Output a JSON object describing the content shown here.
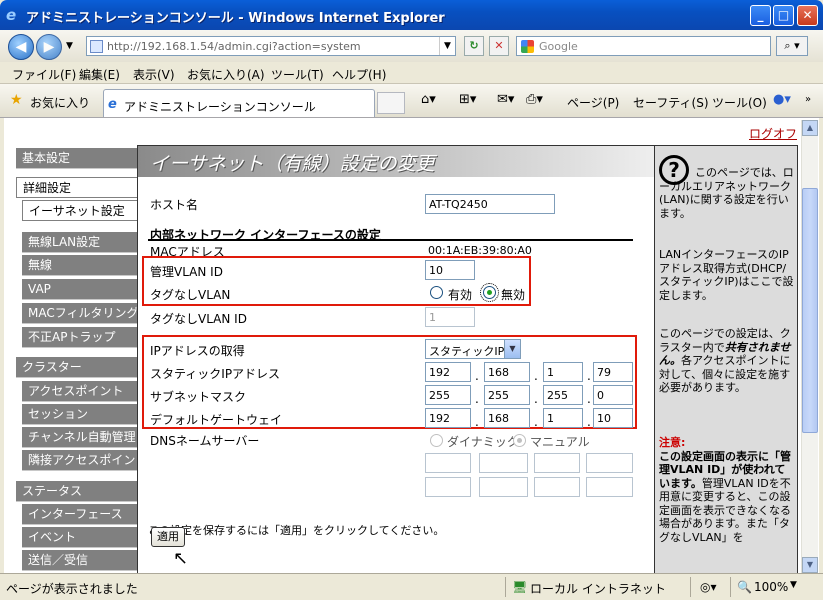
{
  "window": {
    "title": "アドミニストレーションコンソール - Windows Internet Explorer"
  },
  "address": {
    "url": "http://192.168.1.54/admin.cgi?action=system",
    "search_placeholder": "Google"
  },
  "menu": [
    "ファイル(F)",
    "編集(E)",
    "表示(V)",
    "お気に入り(A)",
    "ツール(T)",
    "ヘルプ(H)"
  ],
  "favorites": {
    "label": "お気に入り",
    "tab_title": "アドミニストレーションコンソール"
  },
  "tools": {
    "page": "ページ(P)",
    "safety": "セーフティ(S)",
    "tool": "ツール(O)"
  },
  "logout": "ログオフ",
  "sidebar": [
    {
      "label": "基本設定",
      "type": "main"
    },
    {
      "label": "詳細設定",
      "type": "selected"
    },
    {
      "label": "イーサネット設定",
      "type": "selected-sub"
    },
    {
      "label": "無線LAN設定",
      "type": "sub"
    },
    {
      "label": "無線",
      "type": "sub"
    },
    {
      "label": "VAP",
      "type": "sub"
    },
    {
      "label": "MACフィルタリング",
      "type": "sub"
    },
    {
      "label": "不正APトラップ",
      "type": "sub"
    },
    {
      "label": "クラスター",
      "type": "main"
    },
    {
      "label": "アクセスポイント",
      "type": "sub"
    },
    {
      "label": "セッション",
      "type": "sub"
    },
    {
      "label": "チャンネル自動管理",
      "type": "sub"
    },
    {
      "label": "隣接アクセスポイント",
      "type": "sub"
    },
    {
      "label": "ステータス",
      "type": "main"
    },
    {
      "label": "インターフェース",
      "type": "sub"
    },
    {
      "label": "イベント",
      "type": "sub"
    },
    {
      "label": "送信／受信",
      "type": "sub"
    }
  ],
  "main": {
    "heading": "イーサネット（有線）設定の変更",
    "hostname_label": "ホスト名",
    "hostname_value": "AT-TQ2450",
    "section_title": "内部ネットワーク インターフェースの設定",
    "mac_label": "MACアドレス",
    "mac_value": "00:1A:EB:39:80:A0",
    "mgmt_vlan_label": "管理VLAN ID",
    "mgmt_vlan_value": "10",
    "untagged_label": "タグなしVLAN",
    "enabled": "有効",
    "disabled": "無効",
    "untagged_id_label": "タグなしVLAN ID",
    "untagged_id_value": "1",
    "ip_mode_label": "IPアドレスの取得",
    "ip_mode_value": "スタティックIP",
    "static_ip_label": "スタティックIPアドレス",
    "static_ip": [
      "192",
      "168",
      "1",
      "79"
    ],
    "subnet_label": "サブネットマスク",
    "subnet": [
      "255",
      "255",
      "255",
      "0"
    ],
    "gateway_label": "デフォルトゲートウェイ",
    "gateway": [
      "192",
      "168",
      "1",
      "10"
    ],
    "dns_label": "DNSネームサーバー",
    "dns_dynamic": "ダイナミック",
    "dns_manual": "マニュアル",
    "save_hint": "この設定を保存するには「適用」をクリックしてください。",
    "apply_label": "適用"
  },
  "help": {
    "intro": "このページでは、ローカルエリアネットワーク(LAN)に関する設定を行います。",
    "p2": "LANインターフェースのIPアドレス取得方式(DHCP/スタティックIP)はここで設定します。",
    "p3a": "このページでの設定は、クラスター内で",
    "p3b": "共有されません。",
    "p3c": "各アクセスポイントに対して、個々に設定を施す必要があります。",
    "note_title": "注意:",
    "note_bold": "この設定画面の表示に「管理VLAN ID」が使われています。",
    "note_text": "管理VLAN IDを不用意に変更すると、この設定画面を表示できなくなる場合があります。また「タグなしVLAN」を"
  },
  "status": {
    "left": "ページが表示されました",
    "zone": "ローカル イントラネット",
    "zoom": "100%"
  }
}
